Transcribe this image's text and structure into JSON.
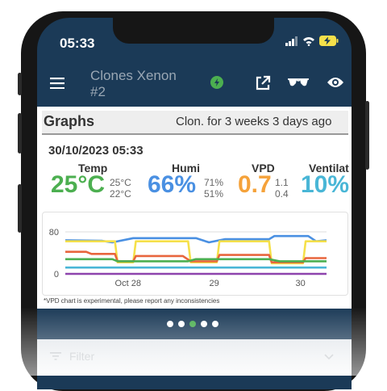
{
  "status_bar": {
    "time": "05:33"
  },
  "appbar": {
    "title": "Clones Xenon #2"
  },
  "graphs": {
    "title": "Graphs",
    "age": "Clon. for 3 weeks 3 days  ago",
    "datetime": "30/10/2023 05:33",
    "metrics": [
      {
        "label": "Temp",
        "value": "25°C",
        "max": "25°C",
        "min": "22°C",
        "color": "#4caf50"
      },
      {
        "label": "Humi",
        "value": "66%",
        "max": "71%",
        "min": "51%",
        "color": "#4a90e2"
      },
      {
        "label": "VPD",
        "value": "0.7",
        "max": "1.1",
        "min": "0.4",
        "color": "#f5a23a"
      },
      {
        "label": "Ventilat",
        "value": "10%",
        "color": "#49b6d6"
      }
    ],
    "note": "*VPD chart is experimental, please report any inconsistencies"
  },
  "pager": {
    "count": 5,
    "active_index": 2
  },
  "filter": {
    "label": "Filter"
  },
  "chart_data": {
    "type": "line",
    "yticks": [
      "80",
      "0"
    ],
    "xticks": [
      "Oct 28",
      "29",
      "30"
    ],
    "series": [
      {
        "color": "#4a90e2",
        "points": [
          [
            0,
            64
          ],
          [
            0.14,
            63
          ],
          [
            0.18,
            60
          ],
          [
            0.26,
            68
          ],
          [
            0.5,
            68
          ],
          [
            0.55,
            60
          ],
          [
            0.61,
            66
          ],
          [
            0.78,
            66
          ],
          [
            0.8,
            72
          ],
          [
            0.93,
            72
          ],
          [
            0.96,
            62
          ],
          [
            1,
            64
          ]
        ]
      },
      {
        "color": "#f5e04a",
        "points": [
          [
            0,
            62
          ],
          [
            0.19,
            62
          ],
          [
            0.2,
            22
          ],
          [
            0.26,
            22
          ],
          [
            0.27,
            62
          ],
          [
            0.47,
            62
          ],
          [
            0.48,
            22
          ],
          [
            0.58,
            22
          ],
          [
            0.59,
            62
          ],
          [
            0.78,
            62
          ],
          [
            0.79,
            20
          ],
          [
            0.91,
            20
          ],
          [
            0.92,
            62
          ],
          [
            1,
            62
          ]
        ]
      },
      {
        "color": "#e8663d",
        "points": [
          [
            0,
            42
          ],
          [
            0.08,
            42
          ],
          [
            0.1,
            38
          ],
          [
            0.19,
            38
          ],
          [
            0.2,
            24
          ],
          [
            0.26,
            24
          ],
          [
            0.27,
            34
          ],
          [
            0.45,
            34
          ],
          [
            0.48,
            24
          ],
          [
            0.58,
            24
          ],
          [
            0.59,
            36
          ],
          [
            0.78,
            36
          ],
          [
            0.79,
            22
          ],
          [
            0.91,
            22
          ],
          [
            0.92,
            30
          ],
          [
            1,
            30
          ]
        ]
      },
      {
        "color": "#4caf50",
        "points": [
          [
            0,
            28
          ],
          [
            0.18,
            28
          ],
          [
            0.2,
            24
          ],
          [
            0.47,
            24
          ],
          [
            0.5,
            28
          ],
          [
            0.78,
            28
          ],
          [
            0.82,
            24
          ],
          [
            1,
            24
          ]
        ]
      },
      {
        "color": "#49b6d6",
        "points": [
          [
            0,
            12
          ],
          [
            1,
            12
          ]
        ]
      },
      {
        "color": "#8e44ad",
        "points": [
          [
            0,
            0
          ],
          [
            1,
            0
          ]
        ]
      }
    ]
  }
}
